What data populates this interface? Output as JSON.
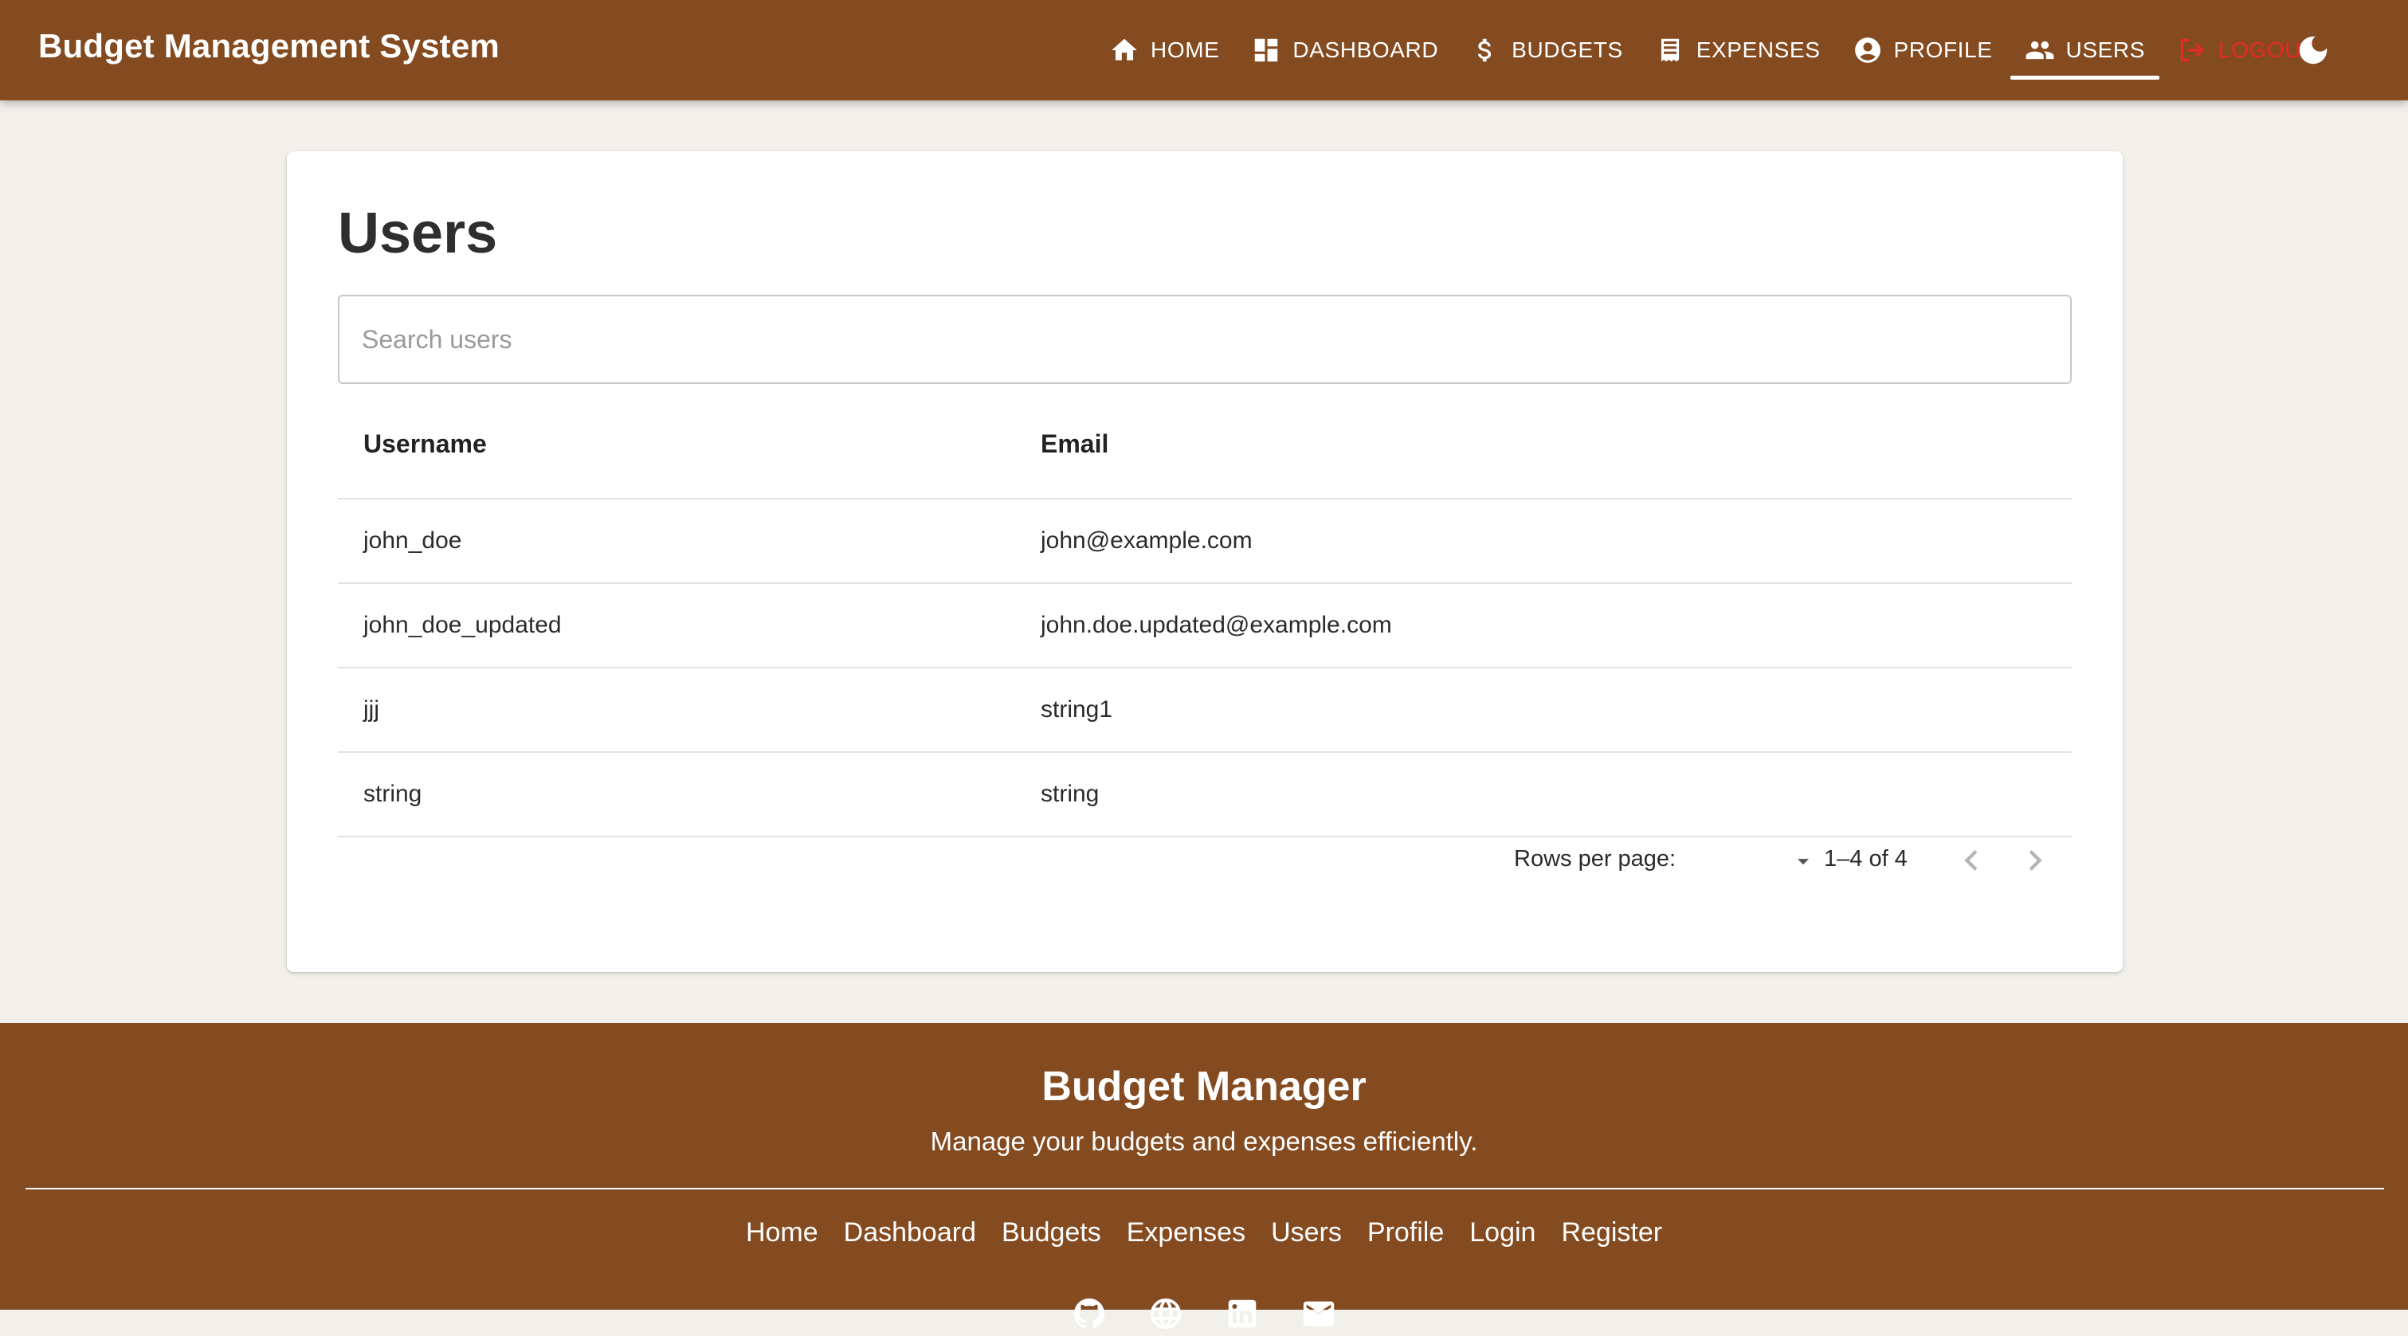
{
  "header": {
    "brand": "Budget Management System",
    "nav": [
      {
        "label": "HOME",
        "icon": "home-icon"
      },
      {
        "label": "DASHBOARD",
        "icon": "dashboard-icon"
      },
      {
        "label": "BUDGETS",
        "icon": "dollar-icon"
      },
      {
        "label": "EXPENSES",
        "icon": "receipt-icon"
      },
      {
        "label": "PROFILE",
        "icon": "account-circle-icon"
      },
      {
        "label": "USERS",
        "icon": "people-icon",
        "active": true
      },
      {
        "label": "LOGOUT",
        "icon": "logout-icon"
      }
    ],
    "theme_toggle_icon": "moon-icon"
  },
  "main": {
    "title": "Users",
    "search": {
      "placeholder": "Search users",
      "value": ""
    },
    "table": {
      "columns": [
        "Username",
        "Email"
      ],
      "rows": [
        [
          "john_doe",
          "john@example.com"
        ],
        [
          "john_doe_updated",
          "john.doe.updated@example.com"
        ],
        [
          "jjj",
          "string1"
        ],
        [
          "string",
          "string"
        ]
      ]
    },
    "pagination": {
      "rows_per_page_label": "Rows per page:",
      "rows_per_page_value": "",
      "range": "1–4 of 4"
    }
  },
  "footer": {
    "title": "Budget Manager",
    "tagline": "Manage your budgets and expenses efficiently.",
    "links": [
      "Home",
      "Dashboard",
      "Budgets",
      "Expenses",
      "Users",
      "Profile",
      "Login",
      "Register"
    ],
    "social_icons": [
      "github-icon",
      "globe-icon",
      "linkedin-icon",
      "mail-icon"
    ]
  },
  "colors": {
    "brand_brown": "#844a20",
    "page_bg": "#f2f0eb",
    "logout_red": "#e8282a"
  }
}
